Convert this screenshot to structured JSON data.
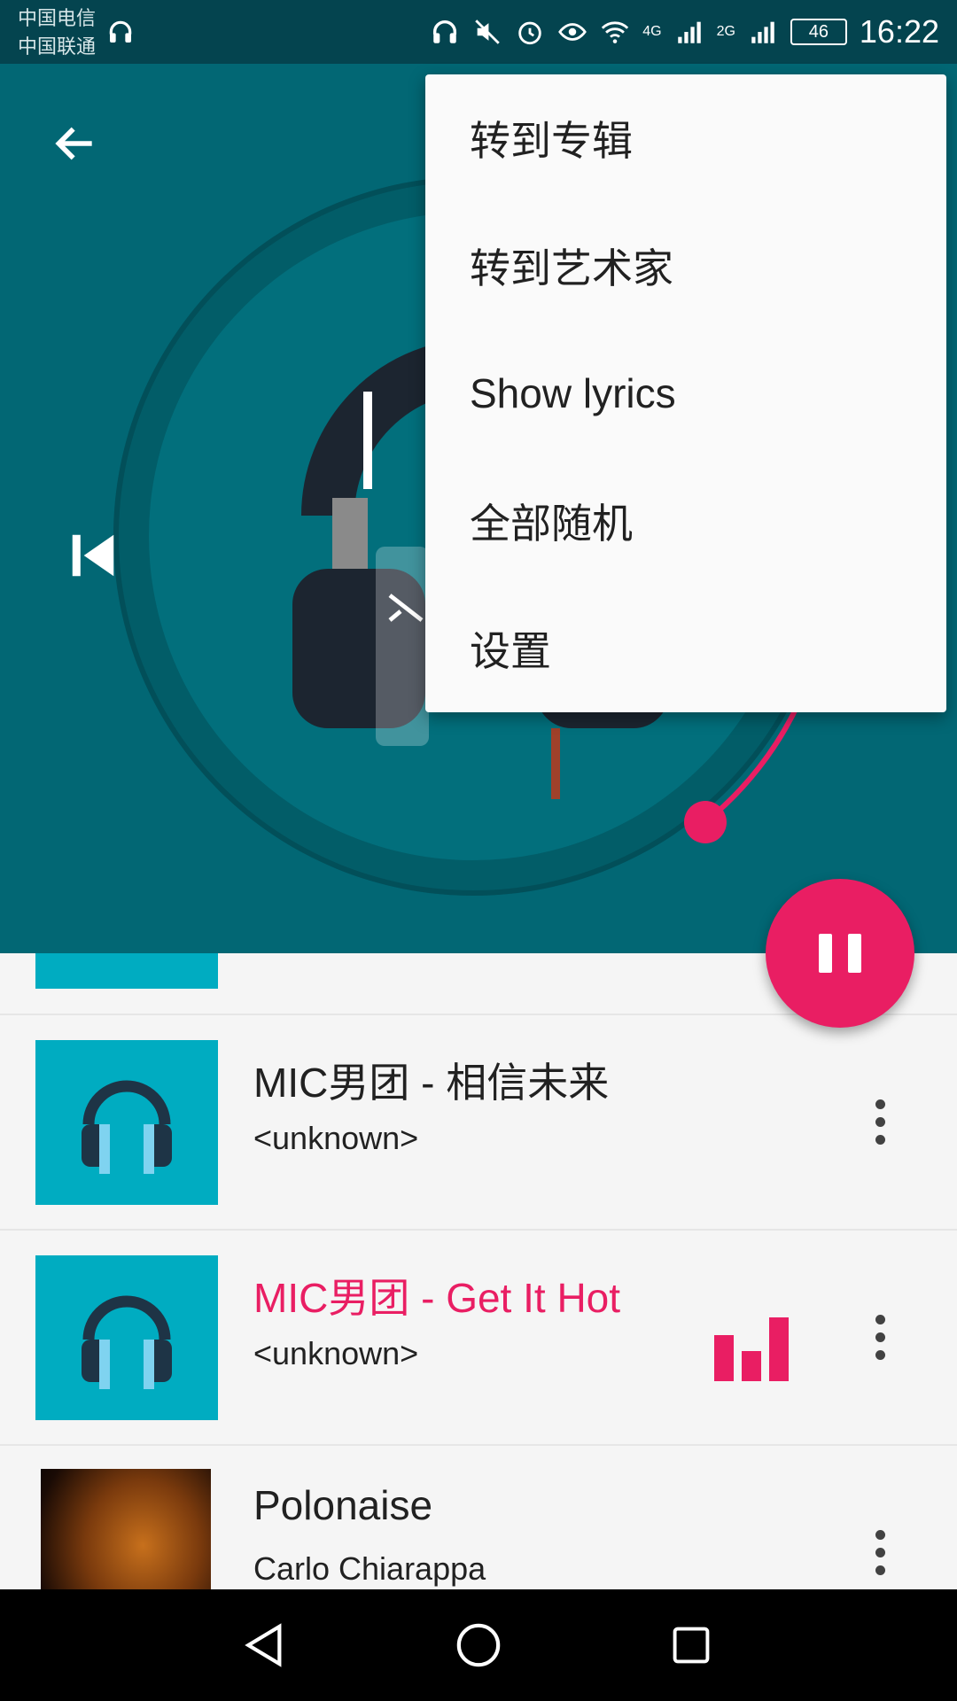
{
  "status_bar": {
    "carrier_1": "中国电信",
    "carrier_2": "中国联通",
    "network_1": "4G",
    "network_2": "2G",
    "battery": "46",
    "time": "16:22",
    "icons": [
      "headset-icon",
      "mute-icon",
      "alarm-icon",
      "eye-icon",
      "wifi-icon",
      "signal-icon",
      "battery-icon"
    ]
  },
  "player": {
    "back_icon": "arrow-left-icon",
    "prev_icon": "skip-previous-icon",
    "pause_icon": "pause-icon",
    "colors": {
      "header": "#026774",
      "accent": "#e91e63"
    }
  },
  "menu": {
    "items": [
      {
        "label": "转到专辑"
      },
      {
        "label": "转到艺术家"
      },
      {
        "label": "Show lyrics"
      },
      {
        "label": "全部随机"
      },
      {
        "label": "设置"
      }
    ]
  },
  "playlist": {
    "items": [
      {
        "title": "MIC男团 - 相信未来",
        "subtitle": "<unknown>",
        "playing": false
      },
      {
        "title": "MIC男团 - Get It Hot",
        "subtitle": "<unknown>",
        "playing": true
      },
      {
        "title": "Polonaise",
        "subtitle": "Carlo Chiarappa",
        "playing": false
      }
    ]
  },
  "nav": {
    "back_icon": "nav-back-icon",
    "home_icon": "nav-home-icon",
    "recents_icon": "nav-recents-icon"
  }
}
